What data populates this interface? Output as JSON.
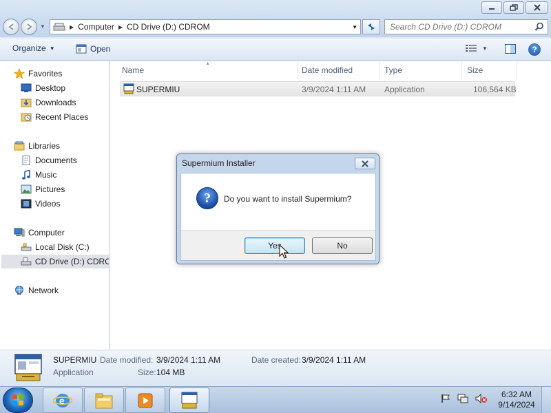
{
  "window": {
    "caption_icons": [
      "minimize-icon",
      "maximize-icon",
      "close-icon"
    ]
  },
  "address": {
    "crumbs": [
      "Computer",
      "CD Drive (D:) CDROM"
    ],
    "search_placeholder": "Search CD Drive (D:) CDROM"
  },
  "commandbar": {
    "organize": "Organize",
    "open": "Open"
  },
  "navpane": {
    "favorites": {
      "header": "Favorites",
      "items": [
        "Desktop",
        "Downloads",
        "Recent Places"
      ]
    },
    "libraries": {
      "header": "Libraries",
      "items": [
        "Documents",
        "Music",
        "Pictures",
        "Videos"
      ]
    },
    "computer": {
      "header": "Computer",
      "items": [
        "Local Disk (C:)",
        "CD Drive (D:) CDROM"
      ]
    },
    "network": {
      "header": "Network"
    }
  },
  "filelist": {
    "columns": [
      "Name",
      "Date modified",
      "Type",
      "Size"
    ],
    "rows": [
      {
        "name": "SUPERMIU",
        "date": "3/9/2024 1:11 AM",
        "type": "Application",
        "size": "106,564 KB"
      }
    ]
  },
  "details": {
    "name": "SUPERMIU",
    "type": "Application",
    "date_modified_label": "Date modified:",
    "date_modified": "3/9/2024 1:11 AM",
    "date_created_label": "Date created:",
    "date_created": "3/9/2024 1:11 AM",
    "size_label": "Size:",
    "size": "104 MB"
  },
  "dialog": {
    "title": "Supermium Installer",
    "message": "Do you want to install Supermium?",
    "yes": "Yes",
    "no": "No"
  },
  "taskbar": {
    "time": "6:32 AM",
    "date": "9/14/2024"
  },
  "colors": {
    "accent": "#3c7fb1",
    "window_frame": "#c4d6ec"
  }
}
